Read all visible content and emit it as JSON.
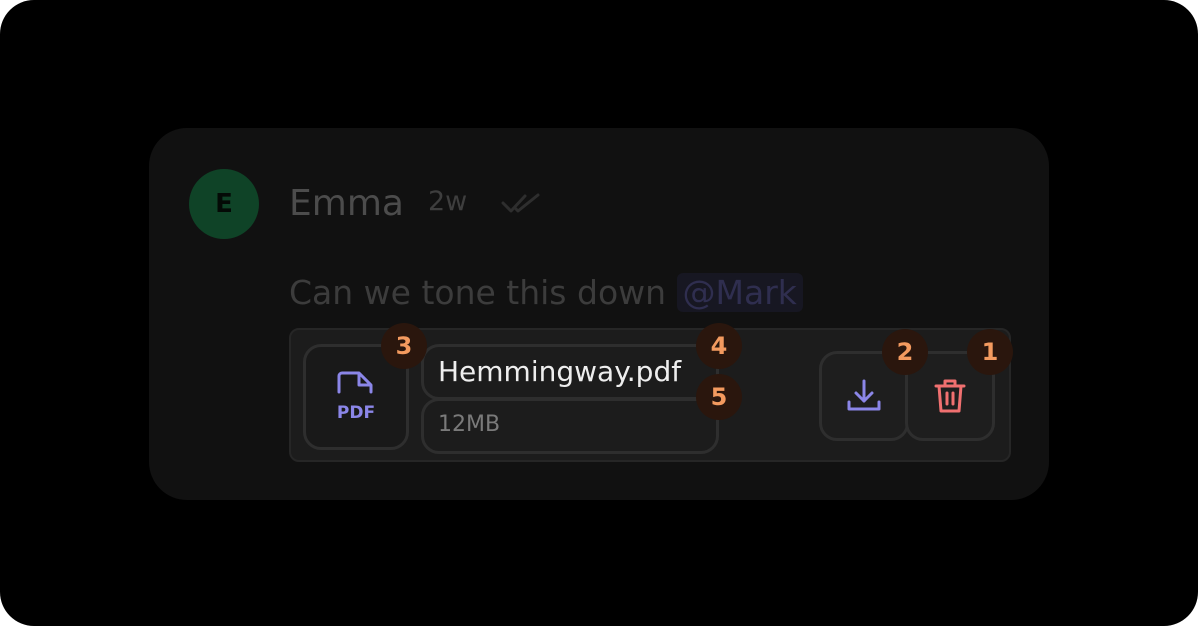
{
  "comment": {
    "avatar_initial": "E",
    "author": "Emma",
    "timestamp": "2w",
    "message_text": "Can we tone this down",
    "mention": "@Mark"
  },
  "attachment": {
    "file_type_label": "PDF",
    "file_name": "Hemmingway.pdf",
    "file_size": "12MB",
    "icons": {
      "file": "pdf-file-icon",
      "download": "download-icon",
      "delete": "trash-icon",
      "read_status": "double-check-icon"
    }
  },
  "markers": [
    "1",
    "2",
    "3",
    "4",
    "5"
  ],
  "colors": {
    "background": "#000000",
    "card": "#111111",
    "avatar": "#0f4327",
    "accent_purple": "#8b86e8",
    "delete_red": "#f07070",
    "marker_text": "#f39a5f",
    "marker_bg": "#2a160d"
  }
}
